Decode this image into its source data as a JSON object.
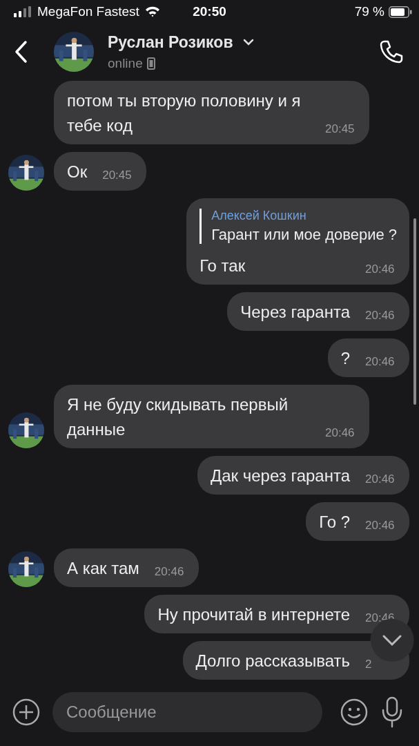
{
  "status_bar": {
    "carrier": "MegaFon Fastest",
    "time": "20:50",
    "battery": "79 %"
  },
  "header": {
    "name": "Руслан Розиков",
    "status": "online"
  },
  "messages": [
    {
      "kind": "incoming",
      "avatar": false,
      "text": "потом ты вторую половину и я тебе код",
      "time": "20:45"
    },
    {
      "kind": "incoming",
      "avatar": true,
      "text": "Ок",
      "time": "20:45"
    },
    {
      "kind": "outgoing",
      "reply": {
        "author": "Алексей Кошкин",
        "text": "Гарант или мое доверие ?"
      },
      "text": "Го так",
      "time": "20:46"
    },
    {
      "kind": "outgoing",
      "text": "Через гаранта",
      "time": "20:46"
    },
    {
      "kind": "outgoing",
      "text": "?",
      "time": "20:46"
    },
    {
      "kind": "incoming",
      "avatar": true,
      "text": "Я не буду скидывать первый данные",
      "time": "20:46"
    },
    {
      "kind": "outgoing",
      "text": "Дак через гаранта",
      "time": "20:46"
    },
    {
      "kind": "outgoing",
      "text": "Го ?",
      "time": "20:46"
    },
    {
      "kind": "incoming",
      "avatar": true,
      "text": "А как там",
      "time": "20:46"
    },
    {
      "kind": "outgoing",
      "text": "Ну прочитай в интернете",
      "time": "20:46"
    },
    {
      "kind": "outgoing",
      "text": "Долго рассказывать",
      "time": "2"
    }
  ],
  "composer": {
    "placeholder": "Сообщение"
  }
}
